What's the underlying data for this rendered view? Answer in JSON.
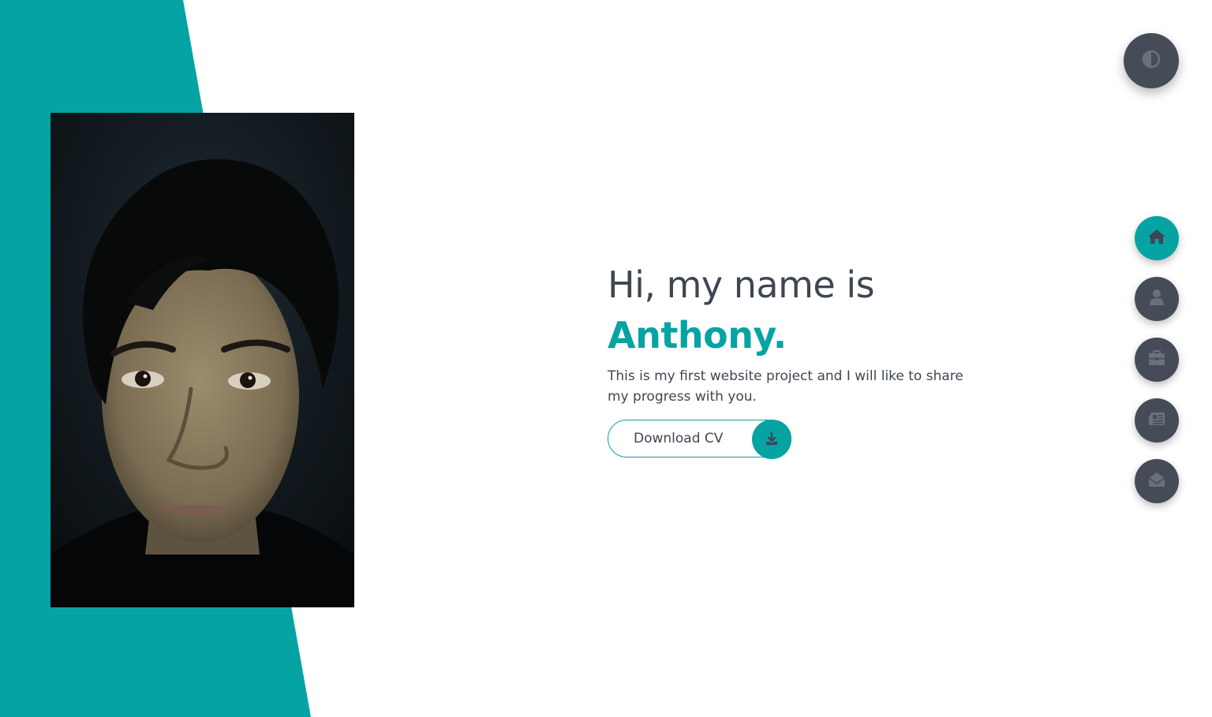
{
  "hero": {
    "greeting": "Hi, my name is",
    "name": "Anthony.",
    "description": "This is my first website project and I will like to share my progress with you.",
    "cta_label": "Download CV"
  },
  "nav": {
    "items": [
      {
        "name": "home",
        "icon": "home-icon",
        "active": true
      },
      {
        "name": "about",
        "icon": "user-icon",
        "active": false
      },
      {
        "name": "portfolio",
        "icon": "briefcase-icon",
        "active": false
      },
      {
        "name": "blogs",
        "icon": "newspaper-icon",
        "active": false
      },
      {
        "name": "contact",
        "icon": "envelope-open-icon",
        "active": false
      }
    ]
  },
  "theme_toggle": {
    "icon": "adjust-icon"
  },
  "colors": {
    "accent": "#06a3a3",
    "dark": "#454c58",
    "text": "#3f4652",
    "background": "#ffffff"
  }
}
